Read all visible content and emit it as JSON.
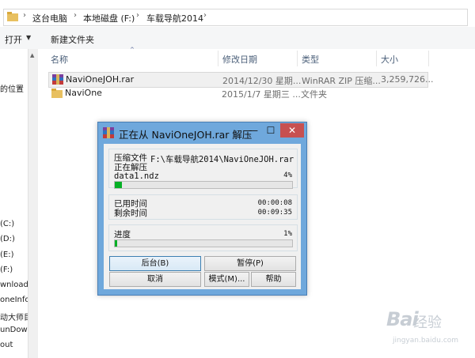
{
  "top_strip": {
    "text": ""
  },
  "address": {
    "crumbs": [
      "这台电脑",
      "本地磁盘 (F:)",
      "车载导航2014"
    ],
    "separator": "›"
  },
  "toolbar": {
    "open_label": "打开",
    "new_folder_label": "新建文件夹"
  },
  "nav": {
    "items": [
      "的位置",
      "(C:)",
      "(D:)",
      "(E:)",
      "(F:)",
      "wnload",
      "oneInfo",
      "动大师目",
      "unDow",
      "out"
    ]
  },
  "filelist": {
    "columns": [
      "名称",
      "修改日期",
      "类型",
      "大小"
    ],
    "rows": [
      {
        "name": "NaviOneJOH.rar",
        "date": "2014/12/30 星期...",
        "type": "WinRAR ZIP 压缩...",
        "size": "3,259,726...",
        "icon": "rar-archive-icon",
        "selected": true
      },
      {
        "name": "NaviOne",
        "date": "2015/1/7 星期三 ...",
        "type": "文件夹",
        "size": "",
        "icon": "folder-icon",
        "selected": false
      }
    ]
  },
  "dialog": {
    "title": "正在从 NaviOneJOH.rar 解压",
    "window_buttons": {
      "minimize": "—",
      "maximize": "☐",
      "close": "✕"
    },
    "archive_label": "压缩文件",
    "archive_path": "F:\\车载导航2014\\NaviOneJOH.rar",
    "status": "正在解压",
    "current_file": "data1.ndz",
    "file_percent": "4%",
    "file_progress": 0.04,
    "elapsed_label": "已用时间",
    "elapsed_value": "00:00:08",
    "remaining_label": "剩余时间",
    "remaining_value": "00:09:35",
    "progress_label": "进度",
    "total_percent": "1%",
    "total_progress": 0.01,
    "buttons": {
      "background": "后台(B)",
      "pause": "暂停(P)",
      "cancel": "取消",
      "mode": "模式(M)...",
      "help": "帮助"
    }
  },
  "watermark": {
    "brand": "Bai",
    "text": "经验",
    "url": "jingyan.baidu.com"
  },
  "colors": {
    "dialog_frame": "#6fa8dc",
    "close_button": "#c75050",
    "progress_fill": "#06b025",
    "header_text": "#4c607a"
  }
}
